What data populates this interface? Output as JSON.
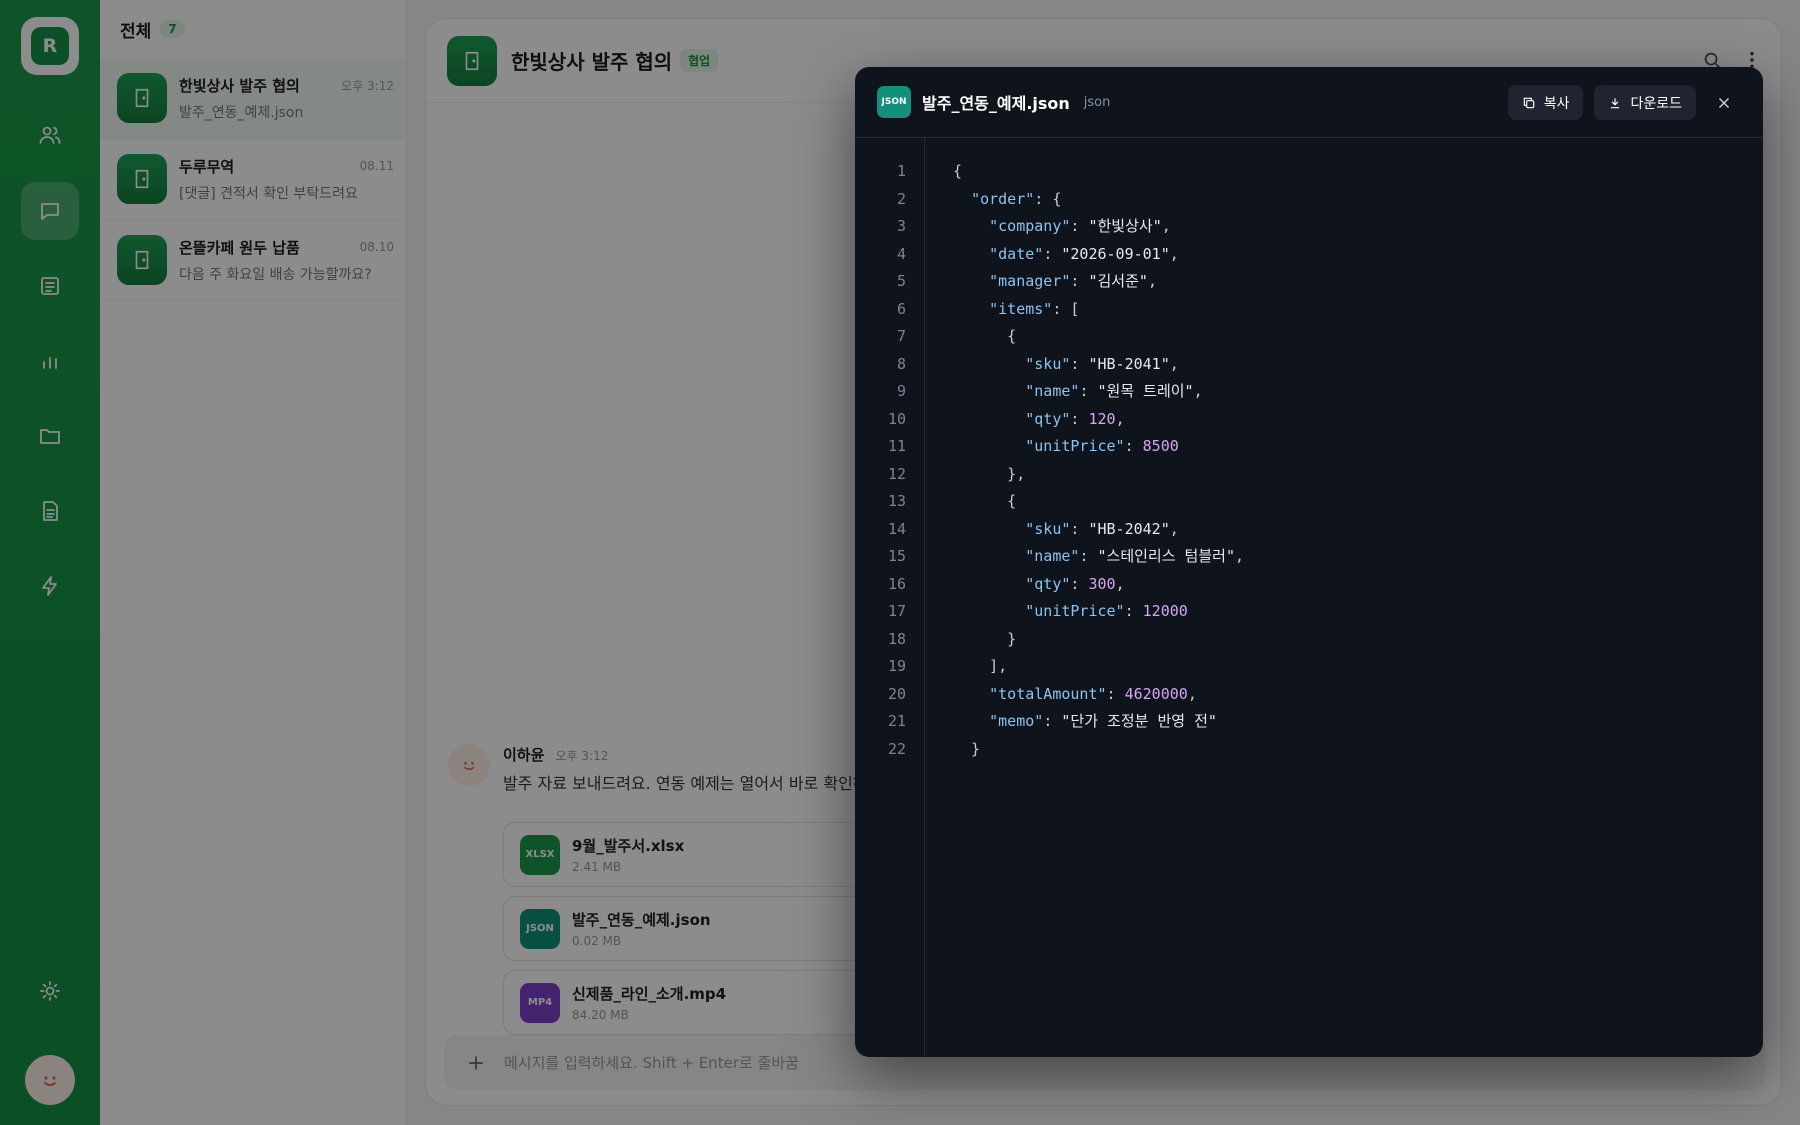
{
  "sidebar": {
    "logo_letter": "R",
    "icons": [
      "people-icon",
      "chat-icon",
      "board-icon",
      "chart-icon",
      "folder-icon",
      "document-icon",
      "bolt-icon"
    ],
    "settings_icon": "gear-icon"
  },
  "chat_list": {
    "title": "전체",
    "count": "7",
    "rooms": [
      {
        "name": "한빛상사 발주 협의",
        "time": "오후 3:12",
        "preview": "발주_연동_예제.json"
      },
      {
        "name": "두루무역",
        "time": "08.11",
        "preview": "[댓글] 견적서 확인 부탁드려요"
      },
      {
        "name": "온뜰카페 원두 납품",
        "time": "08.10",
        "preview": "다음 주 화요일 배송 가능할까요?"
      }
    ]
  },
  "chat": {
    "title": "한빛상사 발주 협의",
    "tag": "협업",
    "message": {
      "sender": "이하윤",
      "time": "오후 3:12",
      "text": "발주 자료 보내드려요. 연동 예제는 열어서 바로 확인하실"
    },
    "files": [
      {
        "badge": "XLSX",
        "name": "9월_발주서.xlsx",
        "size": "2.41 MB",
        "color": "#1a9a49"
      },
      {
        "badge": "JSON",
        "name": "발주_연동_예제.json",
        "size": "0.02 MB",
        "color": "#13907a"
      },
      {
        "badge": "MP4",
        "name": "신제품_라인_소개.mp4",
        "size": "84.20 MB",
        "color": "#7b3fc9"
      }
    ],
    "composer_placeholder": "메시지를 입력하세요. Shift + Enter로 줄바꿈"
  },
  "viewer": {
    "badge": "JSON",
    "filename": "발주_연동_예제.json",
    "type": "json",
    "copy_label": "복사",
    "download_label": "다운로드",
    "line_numbers": [
      "1",
      "2",
      "3",
      "4",
      "5",
      "6",
      "7",
      "8",
      "9",
      "10",
      "11",
      "12",
      "13",
      "14",
      "15",
      "16",
      "17",
      "18",
      "19",
      "20",
      "21",
      "22"
    ],
    "code": {
      "company": "\"한빛상사\"",
      "date": "\"2026-09-01\"",
      "manager": "\"김서준\"",
      "sku1": "\"HB-2041\"",
      "name1": "\"원목 트레이\"",
      "qty1": "120",
      "price1": "8500",
      "sku2": "\"HB-2042\"",
      "name2": "\"스테인리스 텀블러\"",
      "qty2": "300",
      "price2": "12000",
      "total": "4620000",
      "memo": "\"단가 조정분 반영 전\""
    }
  }
}
